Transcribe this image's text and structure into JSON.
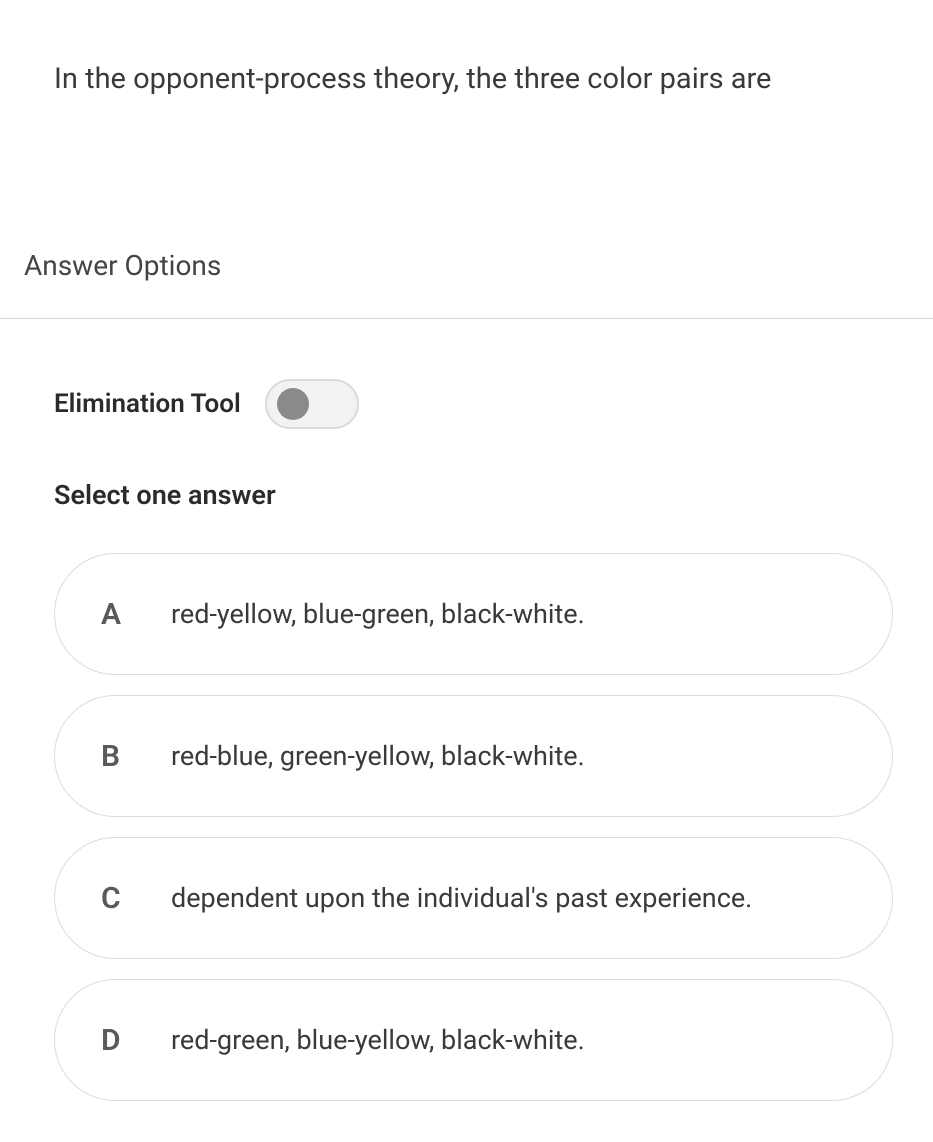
{
  "question": {
    "text": "In the opponent-process theory, the three color pairs are"
  },
  "section_header": "Answer Options",
  "elimination": {
    "label": "Elimination Tool",
    "state": "off"
  },
  "instruction": "Select one answer",
  "options": [
    {
      "letter": "A",
      "text": "red-yellow, blue-green, black-white."
    },
    {
      "letter": "B",
      "text": "red-blue, green-yellow, black-white."
    },
    {
      "letter": "C",
      "text": "dependent upon the individual's past experience."
    },
    {
      "letter": "D",
      "text": "red-green, blue-yellow, black-white."
    }
  ]
}
